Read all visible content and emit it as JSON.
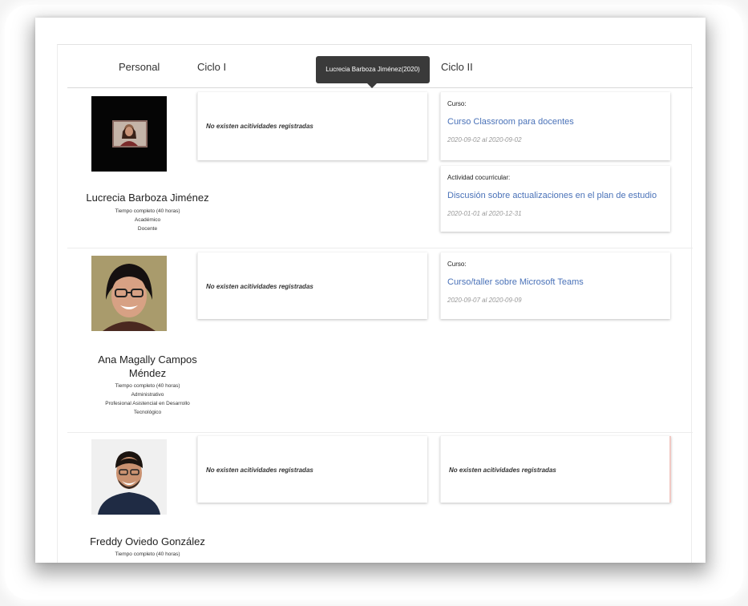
{
  "table": {
    "headers": {
      "personal": "Personal",
      "ciclo1": "Ciclo I",
      "ciclo2": "Ciclo II"
    },
    "tooltip": "Lucrecia Barboza Jiménez(2020)"
  },
  "rows": [
    {
      "name": "Lucrecia Barboza Jiménez",
      "meta": [
        "Tiempo completo (40 horas)",
        "Académico",
        "Docente"
      ],
      "ciclo1_empty": "No existen acitividades registradas",
      "ciclo2": [
        {
          "type": "Curso:",
          "title": "Curso Classroom para docentes",
          "dates": "2020-09-02 al 2020-09-02"
        },
        {
          "type": "Actividad cocurricular:",
          "title": "Discusión sobre actualizaciones en el plan de estudio",
          "dates": "2020-01-01 al 2020-12-31"
        }
      ]
    },
    {
      "name_line1": "Ana Magally Campos",
      "name_line2": "Méndez",
      "meta": [
        "Tiempo completo (40 horas)",
        "Administrativo",
        "Profesional Asistencial en Desarrollo",
        "Tecnológico"
      ],
      "ciclo1_empty": "No existen acitividades registradas",
      "ciclo2": [
        {
          "type": "Curso:",
          "title": "Curso/taller sobre Microsoft Teams",
          "dates": "2020-09-07 al 2020-09-09"
        }
      ]
    },
    {
      "name": "Freddy Oviedo González",
      "meta": [
        "Tiempo completo (40 horas)"
      ],
      "ciclo1_empty": "No existen acitividades registradas",
      "ciclo2_empty": "No existen acitividades registradas"
    }
  ],
  "colors": {
    "link": "#4a72b8",
    "tooltip_bg": "#3a3a3a",
    "card_shadow": "#d0d0d0"
  }
}
